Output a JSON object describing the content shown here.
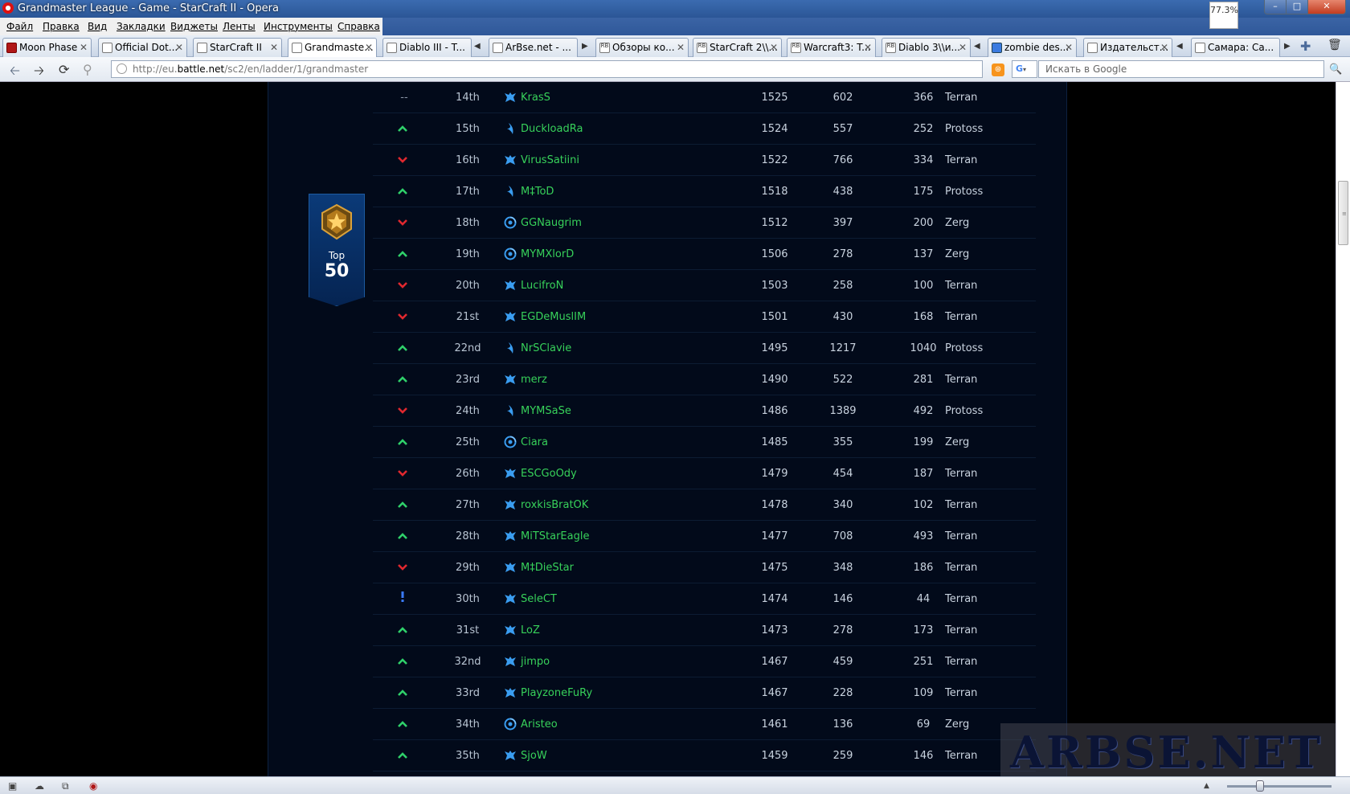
{
  "window": {
    "title": "Grandmaster League - Game - StarCraft II - Opera",
    "zoom_badge": "77.3%"
  },
  "menu": [
    "Файл",
    "Правка",
    "Вид",
    "Закладки",
    "Виджеты",
    "Ленты",
    "Инструменты",
    "Справка"
  ],
  "tabs": [
    {
      "label": "Moon Phase"
    },
    {
      "label": "Official Dot..."
    },
    {
      "label": "StarCraft II"
    },
    {
      "label": "Grandmaste...",
      "active": true
    },
    {
      "label": "Diablo III - T..."
    },
    {
      "label": "ArBse.net - ..."
    },
    {
      "label": "Обзоры ко..."
    },
    {
      "label": "StarCraft 2\\\\..."
    },
    {
      "label": "Warcraft3: T..."
    },
    {
      "label": "Diablo 3\\\\и..."
    },
    {
      "label": "zombie des..."
    },
    {
      "label": "Издательст..."
    },
    {
      "label": "Самара: Са..."
    }
  ],
  "address": {
    "url_prefix": "http://eu.",
    "url_host": "battle.net",
    "url_path": "/sc2/en/ladder/1/grandmaster",
    "search_placeholder": "Искать в Google",
    "search_engine": "G"
  },
  "badge": {
    "label": "Top",
    "number": "50"
  },
  "colors": {
    "player_name": "#37d15a",
    "trend_up": "#2fd06a",
    "trend_down": "#e0282f",
    "trend_new": "#3a7bff"
  },
  "ladder": [
    {
      "trend": "same",
      "trend_text": "--",
      "rank": "14th",
      "race": "Terran",
      "name": "KrasS",
      "points": "1525",
      "wins": "602",
      "losses": "366"
    },
    {
      "trend": "up",
      "rank": "15th",
      "race": "Protoss",
      "name": "DuckloadRa",
      "points": "1524",
      "wins": "557",
      "losses": "252"
    },
    {
      "trend": "down",
      "rank": "16th",
      "race": "Terran",
      "name": "VirusSatiini",
      "points": "1522",
      "wins": "766",
      "losses": "334"
    },
    {
      "trend": "up",
      "rank": "17th",
      "race": "Protoss",
      "name": "M‡ToD",
      "points": "1518",
      "wins": "438",
      "losses": "175"
    },
    {
      "trend": "down",
      "rank": "18th",
      "race": "Zerg",
      "name": "GGNaugrim",
      "points": "1512",
      "wins": "397",
      "losses": "200"
    },
    {
      "trend": "up",
      "rank": "19th",
      "race": "Zerg",
      "name": "MYMXlorD",
      "points": "1506",
      "wins": "278",
      "losses": "137"
    },
    {
      "trend": "down",
      "rank": "20th",
      "race": "Terran",
      "name": "LucifroN",
      "points": "1503",
      "wins": "258",
      "losses": "100"
    },
    {
      "trend": "down",
      "rank": "21st",
      "race": "Terran",
      "name": "EGDeMuslIM",
      "points": "1501",
      "wins": "430",
      "losses": "168"
    },
    {
      "trend": "up",
      "rank": "22nd",
      "race": "Protoss",
      "name": "NrSClavie",
      "points": "1495",
      "wins": "1217",
      "losses": "1040"
    },
    {
      "trend": "up",
      "rank": "23rd",
      "race": "Terran",
      "name": "merz",
      "points": "1490",
      "wins": "522",
      "losses": "281"
    },
    {
      "trend": "down",
      "rank": "24th",
      "race": "Protoss",
      "name": "MYMSaSe",
      "points": "1486",
      "wins": "1389",
      "losses": "492"
    },
    {
      "trend": "up",
      "rank": "25th",
      "race": "Zerg",
      "name": "Ciara",
      "points": "1485",
      "wins": "355",
      "losses": "199"
    },
    {
      "trend": "down",
      "rank": "26th",
      "race": "Terran",
      "name": "ESCGoOdy",
      "points": "1479",
      "wins": "454",
      "losses": "187"
    },
    {
      "trend": "up",
      "rank": "27th",
      "race": "Terran",
      "name": "roxkisBratOK",
      "points": "1478",
      "wins": "340",
      "losses": "102"
    },
    {
      "trend": "up",
      "rank": "28th",
      "race": "Terran",
      "name": "MiTStarEagle",
      "points": "1477",
      "wins": "708",
      "losses": "493"
    },
    {
      "trend": "down",
      "rank": "29th",
      "race": "Terran",
      "name": "M‡DieStar",
      "points": "1475",
      "wins": "348",
      "losses": "186"
    },
    {
      "trend": "new",
      "rank": "30th",
      "race": "Terran",
      "name": "SeleCT",
      "points": "1474",
      "wins": "146",
      "losses": "44"
    },
    {
      "trend": "up",
      "rank": "31st",
      "race": "Terran",
      "name": "LoZ",
      "points": "1473",
      "wins": "278",
      "losses": "173"
    },
    {
      "trend": "up",
      "rank": "32nd",
      "race": "Terran",
      "name": "jimpo",
      "points": "1467",
      "wins": "459",
      "losses": "251"
    },
    {
      "trend": "up",
      "rank": "33rd",
      "race": "Terran",
      "name": "PlayzoneFuRy",
      "points": "1467",
      "wins": "228",
      "losses": "109"
    },
    {
      "trend": "up",
      "rank": "34th",
      "race": "Zerg",
      "name": "Aristeo",
      "points": "1461",
      "wins": "136",
      "losses": "69"
    },
    {
      "trend": "up",
      "rank": "35th",
      "race": "Terran",
      "name": "SjoW",
      "points": "1459",
      "wins": "259",
      "losses": "146"
    }
  ],
  "watermark": "ARBSE.NET"
}
